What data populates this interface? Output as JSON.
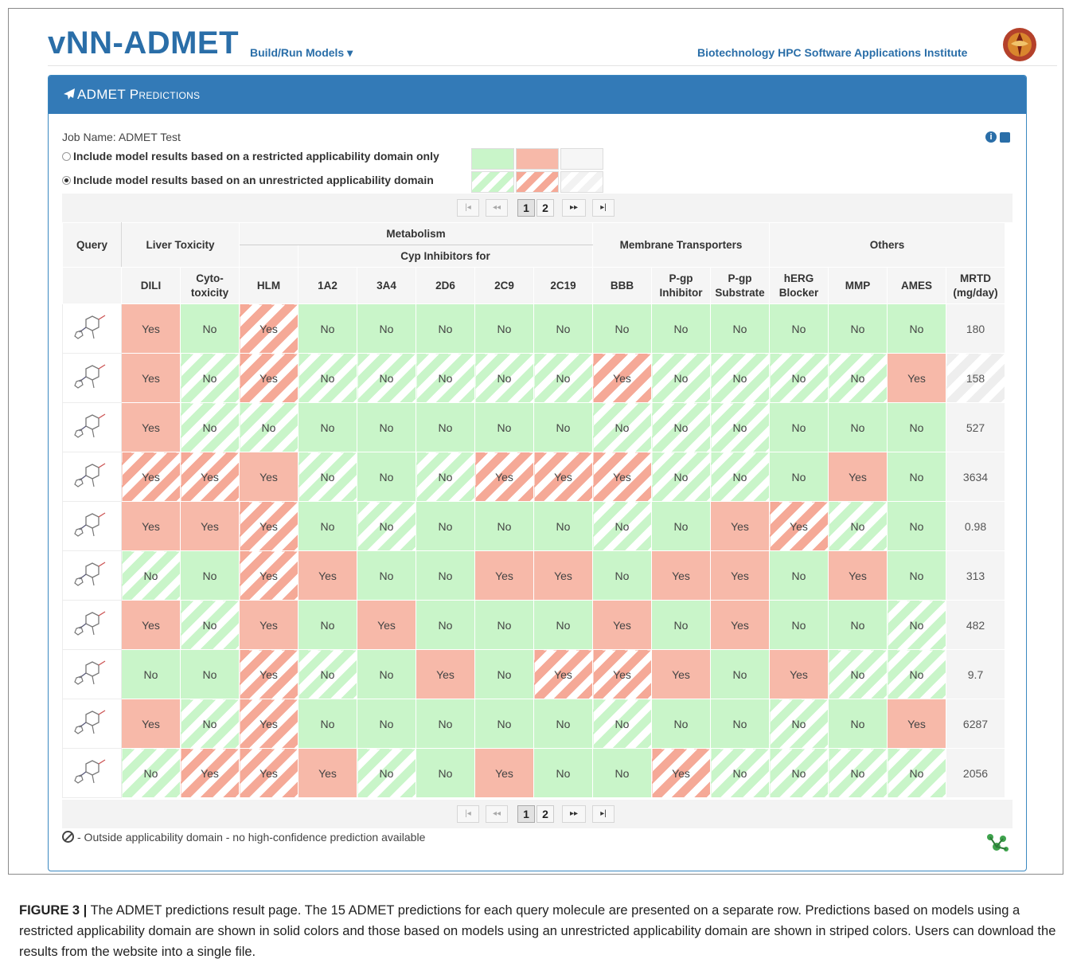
{
  "header": {
    "logo": "vNN-ADMET",
    "menu": "Build/Run Models ▾",
    "institute": "Biotechnology HPC Software Applications Institute"
  },
  "panel": {
    "title": "ADMET Predictions",
    "job_name": "Job Name: ADMET Test",
    "option_restricted": "Include model results based on a restricted applicability domain only",
    "option_unrestricted": "Include model results based on an unrestricted applicability domain",
    "selected_option": "unrestricted",
    "info_icon": "i"
  },
  "pager": {
    "first": "|◂",
    "prev": "◂◂",
    "pages": [
      "1",
      "2"
    ],
    "next": "▸▸",
    "last": "▸|",
    "current_page": 1
  },
  "table": {
    "query_header": "Query",
    "groups": [
      "Liver Toxicity",
      "Metabolism",
      "Membrane Transporters",
      "Others"
    ],
    "metabolism_sub": "Cyp Inhibitors for",
    "columns": [
      "DILI",
      "Cyto-toxicity",
      "HLM",
      "1A2",
      "3A4",
      "2D6",
      "2C9",
      "2C19",
      "BBB",
      "P-gp Inhibitor",
      "P-gp Substrate",
      "hERG Blocker",
      "MMP",
      "AMES",
      "MRTD (mg/day)"
    ],
    "rows": [
      {
        "cells": [
          [
            "Yes",
            "s"
          ],
          [
            "No",
            "s"
          ],
          [
            "Yes",
            "u"
          ],
          [
            "No",
            "s"
          ],
          [
            "No",
            "s"
          ],
          [
            "No",
            "s"
          ],
          [
            "No",
            "s"
          ],
          [
            "No",
            "s"
          ],
          [
            "No",
            "s"
          ],
          [
            "No",
            "s"
          ],
          [
            "No",
            "s"
          ],
          [
            "No",
            "s"
          ],
          [
            "No",
            "s"
          ],
          [
            "No",
            "s"
          ]
        ],
        "mrtd": "180",
        "mrtd_u": false
      },
      {
        "cells": [
          [
            "Yes",
            "s"
          ],
          [
            "No",
            "u"
          ],
          [
            "Yes",
            "u"
          ],
          [
            "No",
            "u"
          ],
          [
            "No",
            "u"
          ],
          [
            "No",
            "u"
          ],
          [
            "No",
            "u"
          ],
          [
            "No",
            "u"
          ],
          [
            "Yes",
            "u"
          ],
          [
            "No",
            "u"
          ],
          [
            "No",
            "u"
          ],
          [
            "No",
            "u"
          ],
          [
            "No",
            "u"
          ],
          [
            "Yes",
            "s"
          ]
        ],
        "mrtd": "158",
        "mrtd_u": true
      },
      {
        "cells": [
          [
            "Yes",
            "s"
          ],
          [
            "No",
            "u"
          ],
          [
            "No",
            "u"
          ],
          [
            "No",
            "s"
          ],
          [
            "No",
            "s"
          ],
          [
            "No",
            "s"
          ],
          [
            "No",
            "s"
          ],
          [
            "No",
            "s"
          ],
          [
            "No",
            "u"
          ],
          [
            "No",
            "u"
          ],
          [
            "No",
            "u"
          ],
          [
            "No",
            "s"
          ],
          [
            "No",
            "s"
          ],
          [
            "No",
            "s"
          ]
        ],
        "mrtd": "527",
        "mrtd_u": false
      },
      {
        "cells": [
          [
            "Yes",
            "u"
          ],
          [
            "Yes",
            "u"
          ],
          [
            "Yes",
            "s"
          ],
          [
            "No",
            "u"
          ],
          [
            "No",
            "s"
          ],
          [
            "No",
            "u"
          ],
          [
            "Yes",
            "u"
          ],
          [
            "Yes",
            "u"
          ],
          [
            "Yes",
            "u"
          ],
          [
            "No",
            "u"
          ],
          [
            "No",
            "u"
          ],
          [
            "No",
            "s"
          ],
          [
            "Yes",
            "s"
          ],
          [
            "No",
            "s"
          ]
        ],
        "mrtd": "3634",
        "mrtd_u": false
      },
      {
        "cells": [
          [
            "Yes",
            "s"
          ],
          [
            "Yes",
            "s"
          ],
          [
            "Yes",
            "u"
          ],
          [
            "No",
            "s"
          ],
          [
            "No",
            "u"
          ],
          [
            "No",
            "s"
          ],
          [
            "No",
            "s"
          ],
          [
            "No",
            "s"
          ],
          [
            "No",
            "u"
          ],
          [
            "No",
            "s"
          ],
          [
            "Yes",
            "s"
          ],
          [
            "Yes",
            "u"
          ],
          [
            "No",
            "u"
          ],
          [
            "No",
            "s"
          ]
        ],
        "mrtd": "0.98",
        "mrtd_u": false
      },
      {
        "cells": [
          [
            "No",
            "u"
          ],
          [
            "No",
            "s"
          ],
          [
            "Yes",
            "u"
          ],
          [
            "Yes",
            "s"
          ],
          [
            "No",
            "s"
          ],
          [
            "No",
            "s"
          ],
          [
            "Yes",
            "s"
          ],
          [
            "Yes",
            "s"
          ],
          [
            "No",
            "s"
          ],
          [
            "Yes",
            "s"
          ],
          [
            "Yes",
            "s"
          ],
          [
            "No",
            "s"
          ],
          [
            "Yes",
            "s"
          ],
          [
            "No",
            "s"
          ]
        ],
        "mrtd": "313",
        "mrtd_u": false
      },
      {
        "cells": [
          [
            "Yes",
            "s"
          ],
          [
            "No",
            "u"
          ],
          [
            "Yes",
            "s"
          ],
          [
            "No",
            "s"
          ],
          [
            "Yes",
            "s"
          ],
          [
            "No",
            "s"
          ],
          [
            "No",
            "s"
          ],
          [
            "No",
            "s"
          ],
          [
            "Yes",
            "s"
          ],
          [
            "No",
            "s"
          ],
          [
            "Yes",
            "s"
          ],
          [
            "No",
            "s"
          ],
          [
            "No",
            "s"
          ],
          [
            "No",
            "u"
          ]
        ],
        "mrtd": "482",
        "mrtd_u": false
      },
      {
        "cells": [
          [
            "No",
            "s"
          ],
          [
            "No",
            "s"
          ],
          [
            "Yes",
            "u"
          ],
          [
            "No",
            "u"
          ],
          [
            "No",
            "s"
          ],
          [
            "Yes",
            "s"
          ],
          [
            "No",
            "s"
          ],
          [
            "Yes",
            "u"
          ],
          [
            "Yes",
            "u"
          ],
          [
            "Yes",
            "s"
          ],
          [
            "No",
            "s"
          ],
          [
            "Yes",
            "s"
          ],
          [
            "No",
            "u"
          ],
          [
            "No",
            "u"
          ]
        ],
        "mrtd": "9.7",
        "mrtd_u": false
      },
      {
        "cells": [
          [
            "Yes",
            "s"
          ],
          [
            "No",
            "u"
          ],
          [
            "Yes",
            "u"
          ],
          [
            "No",
            "s"
          ],
          [
            "No",
            "s"
          ],
          [
            "No",
            "s"
          ],
          [
            "No",
            "s"
          ],
          [
            "No",
            "s"
          ],
          [
            "No",
            "u"
          ],
          [
            "No",
            "s"
          ],
          [
            "No",
            "s"
          ],
          [
            "No",
            "u"
          ],
          [
            "No",
            "s"
          ],
          [
            "Yes",
            "s"
          ]
        ],
        "mrtd": "6287",
        "mrtd_u": false
      },
      {
        "cells": [
          [
            "No",
            "u"
          ],
          [
            "Yes",
            "u"
          ],
          [
            "Yes",
            "u"
          ],
          [
            "Yes",
            "s"
          ],
          [
            "No",
            "u"
          ],
          [
            "No",
            "s"
          ],
          [
            "Yes",
            "s"
          ],
          [
            "No",
            "s"
          ],
          [
            "No",
            "s"
          ],
          [
            "Yes",
            "u"
          ],
          [
            "No",
            "u"
          ],
          [
            "No",
            "u"
          ],
          [
            "No",
            "u"
          ],
          [
            "No",
            "u"
          ]
        ],
        "mrtd": "2056",
        "mrtd_u": false
      }
    ]
  },
  "footnote": "- Outside applicability domain - no high-confidence prediction available",
  "caption": {
    "label": "FIGURE 3 |",
    "text": " The ADMET predictions result page. The 15 ADMET predictions for each query molecule are presented on a separate row. Predictions based on models using a restricted applicability domain are shown in solid colors and those based on models using an unrestricted applicability domain are shown in striped colors. Users can download the results from the website into a single file."
  },
  "colors": {
    "brand_blue": "#337ab7",
    "yes_red": "#f7b9a9",
    "no_green": "#c9f5c9"
  },
  "icons": {
    "panel": "paper-plane-icon",
    "info": "info-circle-icon",
    "download": "download-icon",
    "footnote": "ban-icon",
    "bottom_logo": "molecule-logo-icon"
  }
}
